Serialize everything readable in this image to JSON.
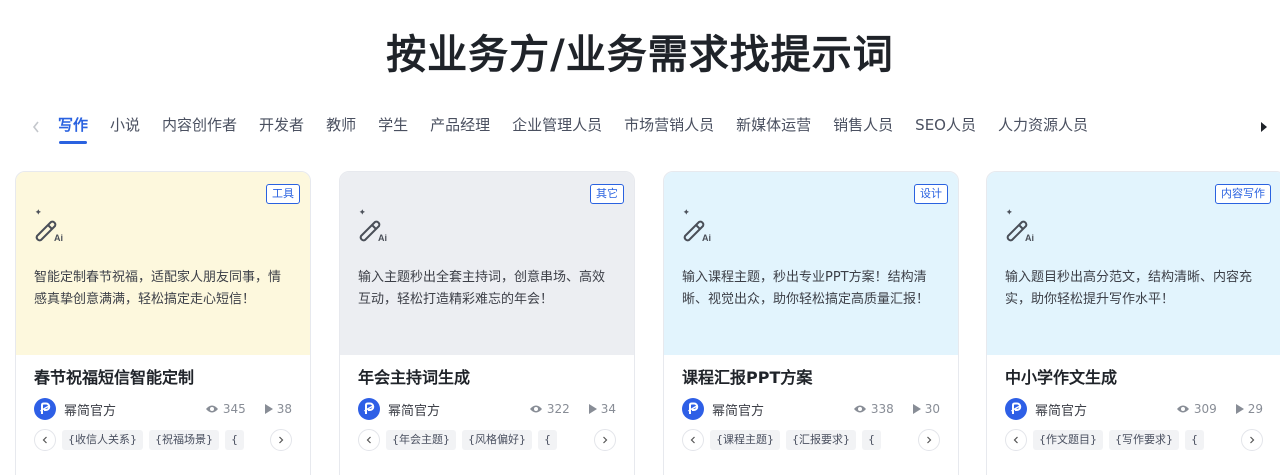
{
  "page": {
    "title": "按业务方/业务需求找提示词"
  },
  "tabs": [
    {
      "label": "写作",
      "active": true
    },
    {
      "label": "小说"
    },
    {
      "label": "内容创作者"
    },
    {
      "label": "开发者"
    },
    {
      "label": "教师"
    },
    {
      "label": "学生"
    },
    {
      "label": "产品经理"
    },
    {
      "label": "企业管理人员"
    },
    {
      "label": "市场营销人员"
    },
    {
      "label": "新媒体运营"
    },
    {
      "label": "销售人员"
    },
    {
      "label": "SEO人员"
    },
    {
      "label": "人力资源人员"
    }
  ],
  "colors": {
    "accent": "#2a62e0",
    "card1_bg": "#fdf8dd",
    "card2_bg": "#eceef2",
    "card3_bg": "#e2f4fd",
    "card4_bg": "#e2f4fd"
  },
  "cards": [
    {
      "badge": "工具",
      "description": "智能定制春节祝福，适配家人朋友同事，情感真挚创意满满，轻松搞定走心短信！",
      "title": "春节祝福短信智能定制",
      "author": "幂简官方",
      "views": "345",
      "uses": "38",
      "tags": [
        "{收信人关系}",
        "{祝福场景}",
        "{"
      ]
    },
    {
      "badge": "其它",
      "description": "输入主题秒出全套主持词，创意串场、高效互动，轻松打造精彩难忘的年会！",
      "title": "年会主持词生成",
      "author": "幂简官方",
      "views": "322",
      "uses": "34",
      "tags": [
        "{年会主题}",
        "{风格偏好}",
        "{"
      ]
    },
    {
      "badge": "设计",
      "description": "输入课程主题，秒出专业PPT方案！结构清晰、视觉出众，助你轻松搞定高质量汇报！",
      "title": "课程汇报PPT方案",
      "author": "幂简官方",
      "views": "338",
      "uses": "30",
      "tags": [
        "{课程主题}",
        "{汇报要求}",
        "{"
      ]
    },
    {
      "badge": "内容写作",
      "description": "输入题目秒出高分范文，结构清晰、内容充实，助你轻松提升写作水平！",
      "title": "中小学作文生成",
      "author": "幂简官方",
      "views": "309",
      "uses": "29",
      "tags": [
        "{作文题目}",
        "{写作要求}",
        "{"
      ]
    }
  ]
}
